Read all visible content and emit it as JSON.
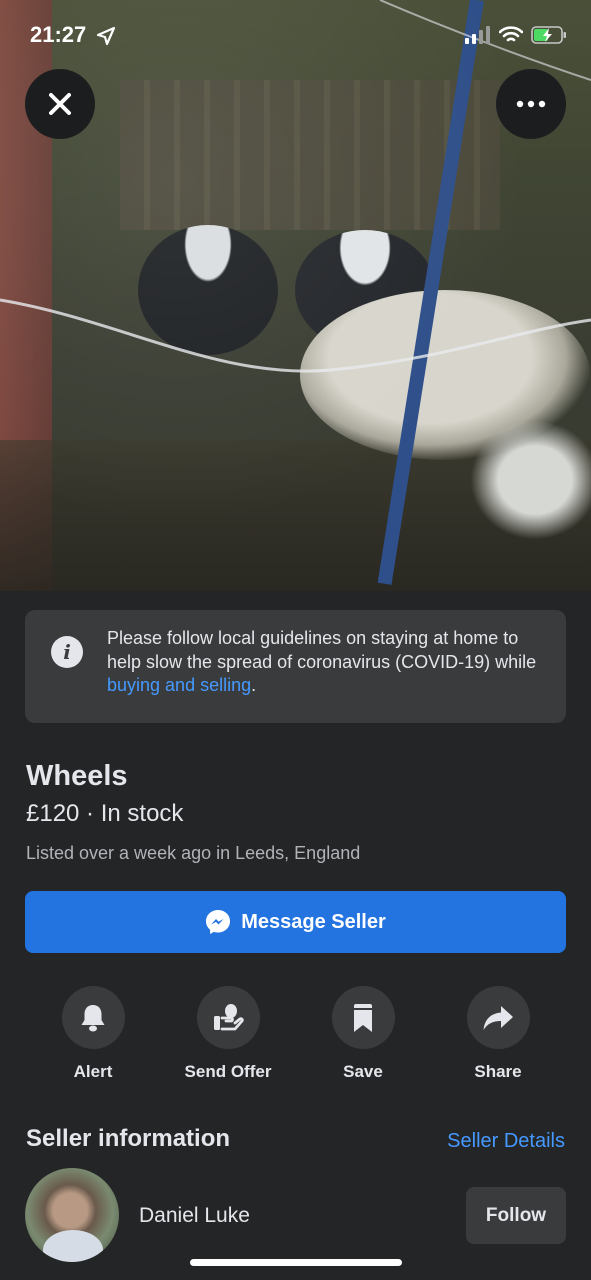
{
  "status_bar": {
    "time": "21:27"
  },
  "notice": {
    "text": "Please follow local guidelines on staying at home to help slow the spread of coronavirus (COVID-19) while ",
    "link": "buying and selling",
    "end": "."
  },
  "listing": {
    "title": "Wheels",
    "price_line": "£120 · In stock",
    "listed": "Listed over a week ago in Leeds, England"
  },
  "message_button": {
    "label": "Message Seller"
  },
  "actions": [
    {
      "label": "Alert",
      "icon": "bell-icon"
    },
    {
      "label": "Send Offer",
      "icon": "offer-hand-icon"
    },
    {
      "label": "Save",
      "icon": "bookmark-icon"
    },
    {
      "label": "Share",
      "icon": "share-arrow-icon"
    }
  ],
  "seller": {
    "heading": "Seller information",
    "details_link": "Seller Details",
    "name": "Daniel Luke",
    "follow_label": "Follow"
  },
  "colors": {
    "background": "#242526",
    "card": "#3a3b3c",
    "accent": "#2374e1",
    "link": "#4599ff"
  }
}
